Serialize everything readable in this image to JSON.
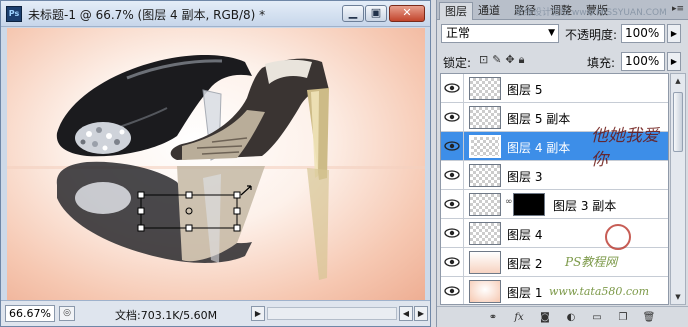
{
  "document": {
    "app_icon": "Ps",
    "title": "未标题-1 @ 66.7% (图层 4 副本, RGB/8) *",
    "window_buttons": {
      "minimize": "▁",
      "restore": "▣",
      "close": "✕"
    },
    "zoom": "66.67%",
    "doc_size": "文档:703.1K/5.60M",
    "nav_prev": "◀",
    "nav_next": "▶"
  },
  "layers_panel": {
    "tabs": [
      "图层",
      "通道",
      "路径",
      "调整",
      "蒙版"
    ],
    "active_tab": 0,
    "watermark_url": "思缘设计论坛 www.MISSYUAN.COM",
    "blend_mode": "正常",
    "opacity_label": "不透明度:",
    "opacity_value": "100%",
    "lock_label": "锁定:",
    "fill_label": "填充:",
    "fill_value": "100%",
    "layers": [
      {
        "name": "图层 5",
        "visible": true,
        "selected": false,
        "thumb": "transparent"
      },
      {
        "name": "图层 5 副本",
        "visible": true,
        "selected": false,
        "thumb": "transparent"
      },
      {
        "name": "图层 4 副本",
        "visible": true,
        "selected": true,
        "thumb": "transparent"
      },
      {
        "name": "图层 3",
        "visible": true,
        "selected": false,
        "thumb": "transparent"
      },
      {
        "name": "图层 3 副本",
        "visible": true,
        "selected": false,
        "thumb": "transparent",
        "mask": true
      },
      {
        "name": "图层 4",
        "visible": true,
        "selected": false,
        "thumb": "transparent"
      },
      {
        "name": "图层 2",
        "visible": true,
        "selected": false,
        "thumb": "gradient"
      },
      {
        "name": "图层 1",
        "visible": true,
        "selected": false,
        "thumb": "background"
      }
    ],
    "footer_icons": [
      "link-icon",
      "fx-icon",
      "mask-icon",
      "adjustment-icon",
      "group-icon",
      "new-layer-icon",
      "trash-icon"
    ]
  },
  "overlay_watermark": {
    "signature": "他她我爱你",
    "site_label": "PS教程网",
    "site_url": "www.tata580.com"
  },
  "colors": {
    "selection": "#3d8ee8",
    "canvas_peach": "#f6c8b2",
    "panel_bg": "#d7dbe1"
  }
}
